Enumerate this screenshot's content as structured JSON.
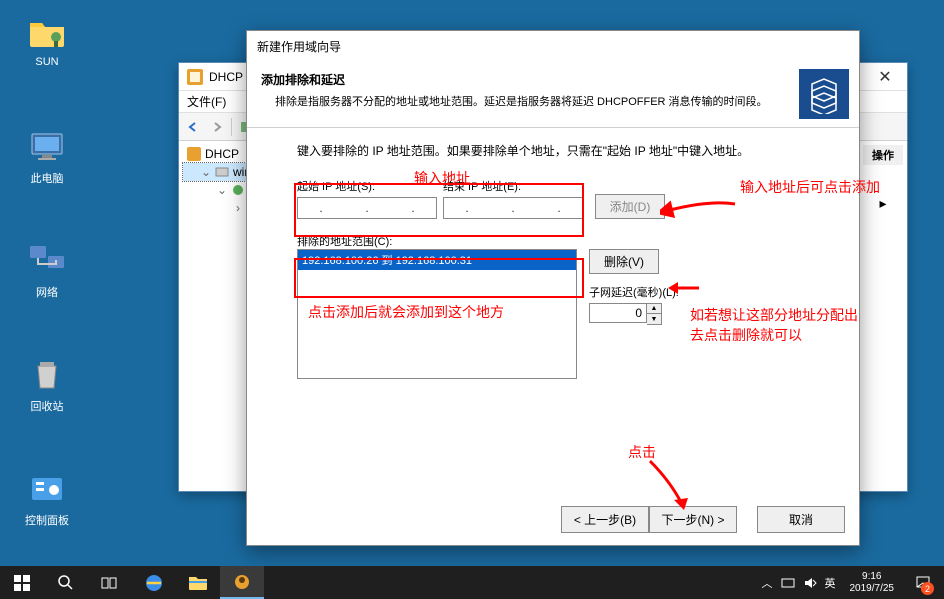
{
  "desktop": {
    "icons": [
      {
        "label": "SUN"
      },
      {
        "label": "此电脑"
      },
      {
        "label": "网络"
      },
      {
        "label": "回收站"
      },
      {
        "label": "控制面板"
      }
    ]
  },
  "dhcp_window": {
    "title": "DHCP",
    "menu": {
      "file": "文件(F)"
    },
    "tree": {
      "root": "DHCP",
      "server": "win",
      "nodes": [
        "",
        ""
      ]
    },
    "actions_header": "操作"
  },
  "wizard": {
    "title": "新建作用域向导",
    "head": {
      "heading": "添加排除和延迟",
      "desc": "排除是指服务器不分配的地址或地址范围。延迟是指服务器将延迟 DHCPOFFER 消息传输的时间段。"
    },
    "body": {
      "intro": "键入要排除的 IP 地址范围。如果要排除单个地址，只需在\"起始 IP 地址\"中键入地址。",
      "start_ip_label": "起始 IP 地址(S):",
      "end_ip_label": "结束 IP 地址(E):",
      "add_btn": "添加(D)",
      "exclusion_label": "排除的地址范围(C):",
      "exclusion_item": "192.168.100.26 到 192.168.100.31",
      "delete_btn": "删除(V)",
      "delay_label": "子网延迟(毫秒)(L):",
      "delay_value": "0"
    },
    "foot": {
      "back": "< 上一步(B)",
      "next": "下一步(N) >",
      "cancel": "取消"
    }
  },
  "annotations": {
    "enter_addr": "输入地址",
    "after_enter": "输入地址后可点击添加",
    "after_add": "点击添加后就会添加到这个地方",
    "if_want": "如若想让这部分地址分配出去点击删除就可以",
    "click": "点击"
  },
  "taskbar": {
    "ime": "英",
    "time": "9:16",
    "date": "2019/7/25",
    "badge": "2"
  }
}
